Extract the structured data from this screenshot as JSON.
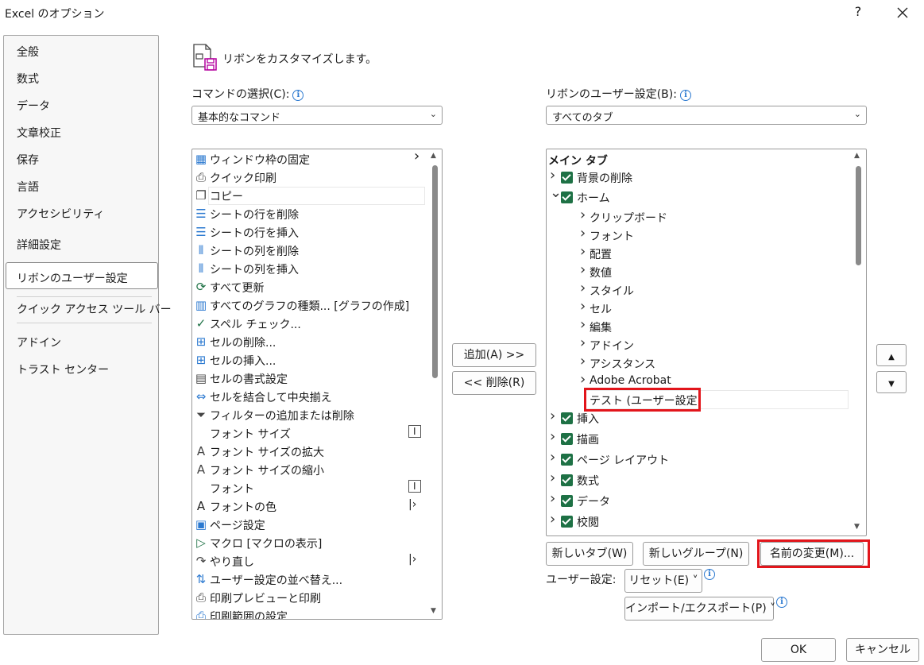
{
  "window": {
    "title": "Excel のオプション",
    "help": "?"
  },
  "nav": {
    "items": [
      {
        "label": "全般"
      },
      {
        "label": "数式"
      },
      {
        "label": "データ"
      },
      {
        "label": "文章校正"
      },
      {
        "label": "保存"
      },
      {
        "label": "言語"
      },
      {
        "label": "アクセシビリティ"
      },
      {
        "label": "詳細設定"
      },
      {
        "label": "リボンのユーザー設定"
      },
      {
        "label": "クイック アクセス ツール バー"
      },
      {
        "label": "アドイン"
      },
      {
        "label": "トラスト センター"
      }
    ]
  },
  "header": {
    "title": "リボンをカスタマイズします。"
  },
  "left": {
    "label": "コマンドの選択(C):",
    "combo": "基本的なコマンド",
    "commands": [
      {
        "label": "ウィンドウ枠の固定",
        "icon": "freeze-panes-icon",
        "sub": ">"
      },
      {
        "label": "クイック印刷",
        "icon": "quick-print-icon"
      },
      {
        "label": "コピー",
        "icon": "copy-icon"
      },
      {
        "label": "シートの行を削除",
        "icon": "delete-rows-icon"
      },
      {
        "label": "シートの行を挿入",
        "icon": "insert-rows-icon"
      },
      {
        "label": "シートの列を削除",
        "icon": "delete-cols-icon"
      },
      {
        "label": "シートの列を挿入",
        "icon": "insert-cols-icon"
      },
      {
        "label": "すべて更新",
        "icon": "refresh-all-icon"
      },
      {
        "label": "すべてのグラフの種類... [グラフの作成]",
        "icon": "chart-icon"
      },
      {
        "label": "スペル チェック...",
        "icon": "spell-check-icon"
      },
      {
        "label": "セルの削除...",
        "icon": "delete-cells-icon"
      },
      {
        "label": "セルの挿入...",
        "icon": "insert-cells-icon"
      },
      {
        "label": "セルの書式設定",
        "icon": "format-cells-icon"
      },
      {
        "label": "セルを結合して中央揃え",
        "icon": "merge-center-icon"
      },
      {
        "label": "フィルターの追加または削除",
        "icon": "filter-icon"
      },
      {
        "label": "フォント サイズ",
        "icon": "",
        "sub": "I"
      },
      {
        "label": "フォント サイズの拡大",
        "icon": "font-grow-icon"
      },
      {
        "label": "フォント サイズの縮小",
        "icon": "font-shrink-icon"
      },
      {
        "label": "フォント",
        "icon": "",
        "sub": "I"
      },
      {
        "label": "フォントの色",
        "icon": "font-color-icon",
        "sub": "|>"
      },
      {
        "label": "ページ設定",
        "icon": "page-setup-icon"
      },
      {
        "label": "マクロ [マクロの表示]",
        "icon": "macro-icon"
      },
      {
        "label": "やり直し",
        "icon": "redo-icon",
        "sub": "|>"
      },
      {
        "label": "ユーザー設定の並べ替え...",
        "icon": "sort-icon"
      },
      {
        "label": "印刷プレビューと印刷",
        "icon": "print-preview-icon"
      },
      {
        "label": "印刷範囲の設定",
        "icon": "print-area-icon"
      }
    ]
  },
  "middle": {
    "add": "追加(A) >>",
    "remove": "<< 削除(R)"
  },
  "right": {
    "label": "リボンのユーザー設定(B):",
    "combo": "すべてのタブ",
    "tree": [
      {
        "label": "メイン タブ",
        "level": 0,
        "bold": true
      },
      {
        "label": "背景の削除",
        "level": 1,
        "exp": ">",
        "check": true
      },
      {
        "label": "ホーム",
        "level": 1,
        "exp": "v",
        "check": true
      },
      {
        "label": "クリップボード",
        "level": 2,
        "exp": ">"
      },
      {
        "label": "フォント",
        "level": 2,
        "exp": ">"
      },
      {
        "label": "配置",
        "level": 2,
        "exp": ">"
      },
      {
        "label": "数値",
        "level": 2,
        "exp": ">"
      },
      {
        "label": "スタイル",
        "level": 2,
        "exp": ">"
      },
      {
        "label": "セル",
        "level": 2,
        "exp": ">"
      },
      {
        "label": "編集",
        "level": 2,
        "exp": ">"
      },
      {
        "label": "アドイン",
        "level": 2,
        "exp": ">"
      },
      {
        "label": "アシスタンス",
        "level": 2,
        "exp": ">"
      },
      {
        "label": "Adobe Acrobat",
        "level": 2,
        "exp": ">"
      },
      {
        "label": "テスト (ユーザー設定)",
        "level": 2,
        "exp": "",
        "selected": true
      },
      {
        "label": "挿入",
        "level": 1,
        "exp": ">",
        "check": true
      },
      {
        "label": "描画",
        "level": 1,
        "exp": ">",
        "check": true
      },
      {
        "label": "ページ レイアウト",
        "level": 1,
        "exp": ">",
        "check": true
      },
      {
        "label": "数式",
        "level": 1,
        "exp": ">",
        "check": true
      },
      {
        "label": "データ",
        "level": 1,
        "exp": ">",
        "check": true
      },
      {
        "label": "校閲",
        "level": 1,
        "exp": ">",
        "check": true
      }
    ],
    "new_tab": "新しいタブ(W)",
    "new_group": "新しいグループ(N)",
    "rename": "名前の変更(M)...",
    "user_settings_label": "ユーザー設定:",
    "reset": "リセット(E) ˅",
    "import_export": "インポート/エクスポート(P) ˅"
  },
  "footer": {
    "ok": "OK",
    "cancel": "キャンセル"
  }
}
